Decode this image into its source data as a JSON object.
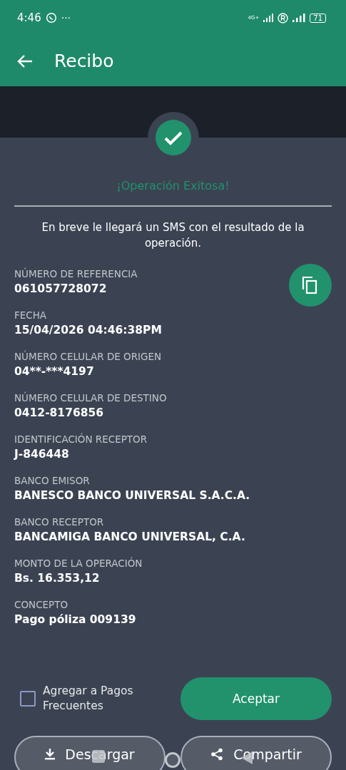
{
  "status_bar": {
    "time": "4:46",
    "dots": "···",
    "network": "4G+",
    "battery": "71"
  },
  "app_bar": {
    "title": "Recibo"
  },
  "result": {
    "title": "¡Operación Exitosa!",
    "message": "En breve le llegará un SMS con el resultado de la operación."
  },
  "fields": [
    {
      "label": "NÚMERO DE REFERENCIA",
      "value": "061057728072"
    },
    {
      "label": "FECHA",
      "value": "15/04/2026 04:46:38PM"
    },
    {
      "label": "NÚMERO CELULAR DE ORIGEN",
      "value": "04**-***4197"
    },
    {
      "label": "NÚMERO CELULAR DE DESTINO",
      "value": "0412-8176856"
    },
    {
      "label": "IDENTIFICACIÓN RECEPTOR",
      "value": "J-846448"
    },
    {
      "label": "BANCO EMISOR",
      "value": "BANESCO BANCO UNIVERSAL S.A.C.A."
    },
    {
      "label": "BANCO RECEPTOR",
      "value": "BANCAMIGA BANCO UNIVERSAL, C.A."
    },
    {
      "label": "MONTO DE LA OPERACIÓN",
      "value": "Bs. 16.353,12"
    },
    {
      "label": "CONCEPTO",
      "value": "Pago póliza 009139"
    }
  ],
  "frequent": {
    "label": "Agregar a Pagos Frecuentes",
    "checked": false
  },
  "accept_button": "Aceptar",
  "actions": [
    {
      "kind": "download",
      "label": "Descargar"
    },
    {
      "kind": "share",
      "label": "Compartir"
    }
  ]
}
